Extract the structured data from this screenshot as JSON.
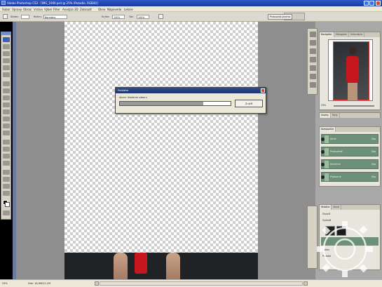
{
  "app": {
    "title": "Adobe Photoshop CS3 - [IMG_1000.psd @ 25% (Pozadie, RGB/8)]"
  },
  "menu": {
    "items": [
      "Súbor",
      "Úpravy",
      "Obraz",
      "Vrstva",
      "Výber",
      "Filter",
      "Analýza",
      "3D",
      "Zobraziť",
      "Okno",
      "Nápoveda",
      "Lekcie"
    ]
  },
  "options": {
    "brush_label": "Štetec:",
    "mode_label": "Režim:",
    "mode_value": "Normálny",
    "opacity_label": "Krytie:",
    "opacity_value": "100%",
    "flow_label": "Tok:",
    "flow_value": "100%",
    "workspace_button": "Pracovná plocha"
  },
  "dialog": {
    "title": "Prebieha",
    "message": "Akcia: Uloženie súboru",
    "cancel_label": "Zrušiť",
    "progress": 0.75
  },
  "navigator": {
    "tabs": [
      "Navigátor",
      "Histogram",
      "Informácie"
    ],
    "zoom": "25%"
  },
  "swatches": {
    "tabs": [
      "Vzorky",
      "Štýly"
    ]
  },
  "layer_comps": {
    "tabs": [
      "Kompozície"
    ],
    "rows": [
      {
        "name": "Akcie",
        "value": "Zap"
      },
      {
        "name": "Predvolené",
        "value": "Zap"
      },
      {
        "name": "Kreslenie",
        "value": "Zap"
      },
      {
        "name": "Produkcia",
        "value": "Zap"
      }
    ]
  },
  "history": {
    "tabs": [
      "História",
      "Akcie"
    ],
    "rows": [
      "Otvoriť",
      "Vyrezať",
      "Štetec",
      "Pozadie"
    ]
  },
  "status": {
    "zoom": "25%",
    "doc": "Dok: 16,9M/12,1M"
  },
  "colors": {
    "accent": "#2f59c7",
    "progress": "#9a9a9a",
    "comp_row": "#6d9079"
  }
}
